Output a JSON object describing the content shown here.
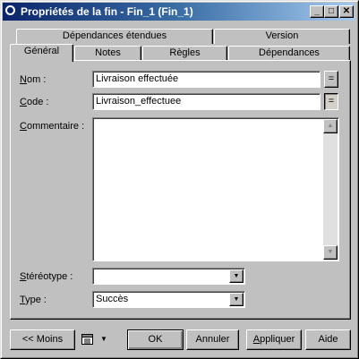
{
  "window": {
    "title": "Propriétés de la fin - Fin_1 (Fin_1)"
  },
  "titlebar_buttons": {
    "minimize": "_",
    "maximize": "□",
    "close": "✕"
  },
  "tabs": {
    "row_back": [
      "Dépendances étendues",
      "Version"
    ],
    "row_front": [
      "Général",
      "Notes",
      "Règles",
      "Dépendances"
    ],
    "active": "Général"
  },
  "general": {
    "nom_label": "Nom :",
    "nom_mnemonic": "N",
    "nom_rest": "om :",
    "nom_value": "Livraison effectuée",
    "code_label": "Code :",
    "code_mnemonic": "C",
    "code_rest": "ode :",
    "code_value": "Livraison_effectuee",
    "eq_label": "=",
    "commentaire_label": "Commentaire :",
    "commentaire_mnemonic": "C",
    "commentaire_rest": "ommentaire :",
    "commentaire_value": "",
    "stereotype_label": "Stéréotype :",
    "stereotype_mnemonic": "S",
    "stereotype_rest": "téréotype :",
    "stereotype_value": "",
    "type_label": "Type :",
    "type_mnemonic": "T",
    "type_rest": "ype :",
    "type_value": "Succès"
  },
  "buttons": {
    "moins": "<< Moins",
    "ok": "OK",
    "annuler": "Annuler",
    "appliquer": "Appliquer",
    "appliquer_mnemonic": "A",
    "appliquer_rest": "ppliquer",
    "aide": "Aide"
  },
  "icons": {
    "scroll_up": "▲",
    "scroll_down": "▼",
    "dropdown": "▼",
    "menu": "list-menu-icon",
    "menu_arrow": "▼",
    "window": "circle-window-icon"
  }
}
